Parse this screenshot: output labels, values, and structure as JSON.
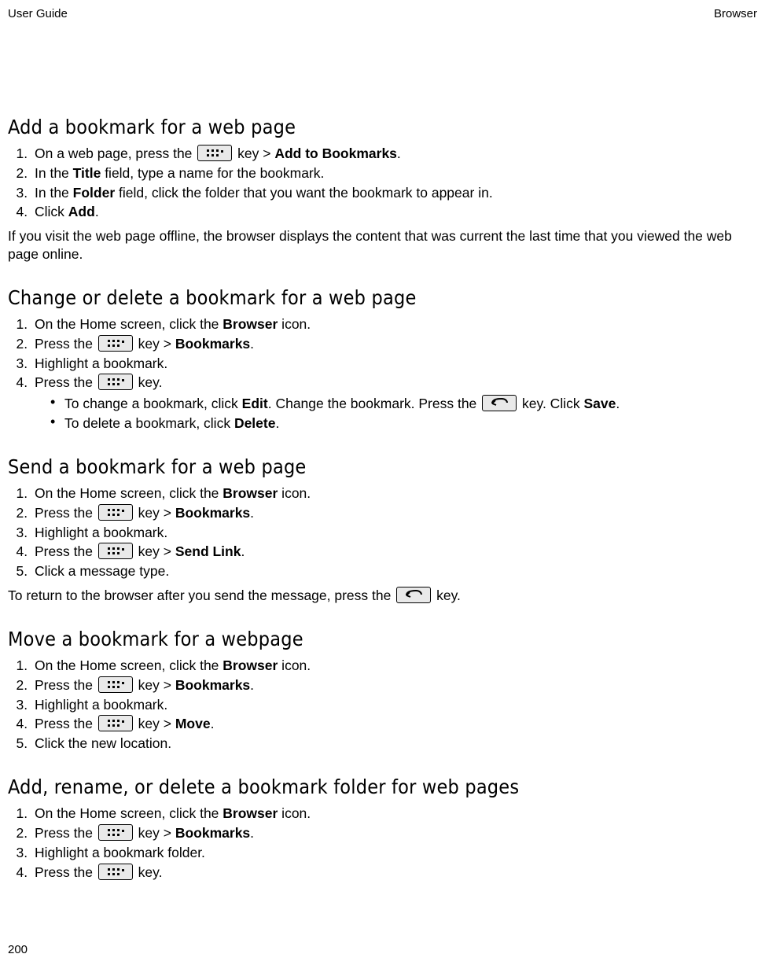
{
  "header": {
    "left": "User Guide",
    "right": "Browser"
  },
  "pagenum": "200",
  "icons": {
    "menuKeyAlt": "Menu key",
    "backKeyAlt": "Back key"
  },
  "sections": {
    "s1": {
      "title": "Add a bookmark for a web page",
      "step1_a": "On a web page, press the ",
      "step1_b": " key > ",
      "step1_c": "Add to Bookmarks",
      "step1_d": ".",
      "step2_a": "In the ",
      "step2_b": "Title",
      "step2_c": " field, type a name for the bookmark.",
      "step3_a": "In the ",
      "step3_b": "Folder",
      "step3_c": " field, click the folder that you want the bookmark to appear in.",
      "step4_a": "Click ",
      "step4_b": "Add",
      "step4_c": ".",
      "note": "If you visit the web page offline, the browser displays the content that was current the last time that you viewed the web page online."
    },
    "s2": {
      "title": "Change or delete a bookmark for a web page",
      "step1_a": "On the Home screen, click the ",
      "step1_b": "Browser",
      "step1_c": " icon.",
      "step2_a": "Press the ",
      "step2_b": " key > ",
      "step2_c": "Bookmarks",
      "step2_d": ".",
      "step3": "Highlight a bookmark.",
      "step4_a": "Press the ",
      "step4_b": " key.",
      "sub1_a": "To change a bookmark, click ",
      "sub1_b": "Edit",
      "sub1_c": ". Change the bookmark. Press the ",
      "sub1_d": " key. Click ",
      "sub1_e": "Save",
      "sub1_f": ".",
      "sub2_a": "To delete a bookmark, click ",
      "sub2_b": "Delete",
      "sub2_c": "."
    },
    "s3": {
      "title": "Send a bookmark for a web page",
      "step1_a": "On the Home screen, click the ",
      "step1_b": "Browser",
      "step1_c": " icon.",
      "step2_a": "Press the ",
      "step2_b": " key > ",
      "step2_c": "Bookmarks",
      "step2_d": ".",
      "step3": "Highlight a bookmark.",
      "step4_a": "Press the ",
      "step4_b": " key > ",
      "step4_c": "Send Link",
      "step4_d": ".",
      "step5": "Click a message type.",
      "note_a": "To return to the browser after you send the message, press the ",
      "note_b": " key."
    },
    "s4": {
      "title": "Move a bookmark for a webpage",
      "step1_a": "On the Home screen, click the ",
      "step1_b": "Browser",
      "step1_c": " icon.",
      "step2_a": "Press the ",
      "step2_b": " key > ",
      "step2_c": "Bookmarks",
      "step2_d": ".",
      "step3": "Highlight a bookmark.",
      "step4_a": "Press the ",
      "step4_b": " key > ",
      "step4_c": "Move",
      "step4_d": ".",
      "step5": "Click the new location."
    },
    "s5": {
      "title": "Add, rename, or delete a bookmark folder for web pages",
      "step1_a": "On the Home screen, click the ",
      "step1_b": "Browser",
      "step1_c": " icon.",
      "step2_a": "Press the ",
      "step2_b": " key > ",
      "step2_c": "Bookmarks",
      "step2_d": ".",
      "step3": "Highlight a bookmark folder.",
      "step4_a": "Press the ",
      "step4_b": " key."
    }
  }
}
